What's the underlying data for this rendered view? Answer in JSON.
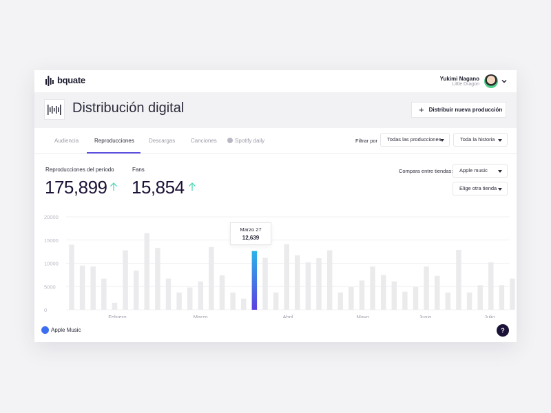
{
  "app": {
    "logo_text": "bquate"
  },
  "user": {
    "name": "Yukimi Nagano",
    "subtitle": "Little Dragon"
  },
  "header": {
    "title": "Distribución digital",
    "new_button_label": "Distribuir nueva producción"
  },
  "tabs": [
    {
      "label": "Audiencia"
    },
    {
      "label": "Reproducciones",
      "active": true
    },
    {
      "label": "Descargas"
    },
    {
      "label": "Canciones"
    },
    {
      "label": "Spotify daily",
      "icon": "spotify-icon"
    }
  ],
  "filters": {
    "label": "Filtrar por",
    "productions": "Todas las producciones",
    "history": "Toda la historia"
  },
  "metrics": {
    "plays_label": "Reproducciones del periodo",
    "plays_value": "175,899",
    "fans_label": "Fans",
    "fans_value": "15,854",
    "trend_color": "#4fd8b4"
  },
  "compare": {
    "label": "Compara entre tiendas:",
    "store_1": "Apple music",
    "store_2": "Elige otra tienda"
  },
  "tooltip": {
    "date": "Marzo 27",
    "value": "12,639"
  },
  "legend": {
    "label": "Apple Music",
    "color": "#3d6df0"
  },
  "help": {
    "label": "?"
  },
  "colors": {
    "accent": "#5b4fe0",
    "highlight_top": "#2ab4e8",
    "highlight_bottom": "#5b3fe0",
    "bar": "#ebebed"
  },
  "chart_data": {
    "type": "bar",
    "ylim": [
      0,
      20000
    ],
    "y_ticks": [
      "0",
      "5000",
      "10000",
      "15000",
      "20000"
    ],
    "x_month_labels": [
      "Febrero",
      "Marzo",
      "Abril",
      "Mayo",
      "Junio",
      "Julio"
    ],
    "grid": true,
    "highlight_index": 17,
    "values": [
      14000,
      9500,
      9300,
      6700,
      1500,
      12800,
      8400,
      16500,
      13300,
      6700,
      3700,
      4800,
      6100,
      13500,
      7400,
      3700,
      2400,
      12639,
      11200,
      3700,
      14100,
      11700,
      10200,
      11100,
      12800,
      3700,
      4900,
      6300,
      9300,
      7500,
      6100,
      3900,
      4900,
      9300,
      7300,
      3700,
      12900,
      3700,
      5300,
      10200,
      5300,
      6700
    ]
  }
}
